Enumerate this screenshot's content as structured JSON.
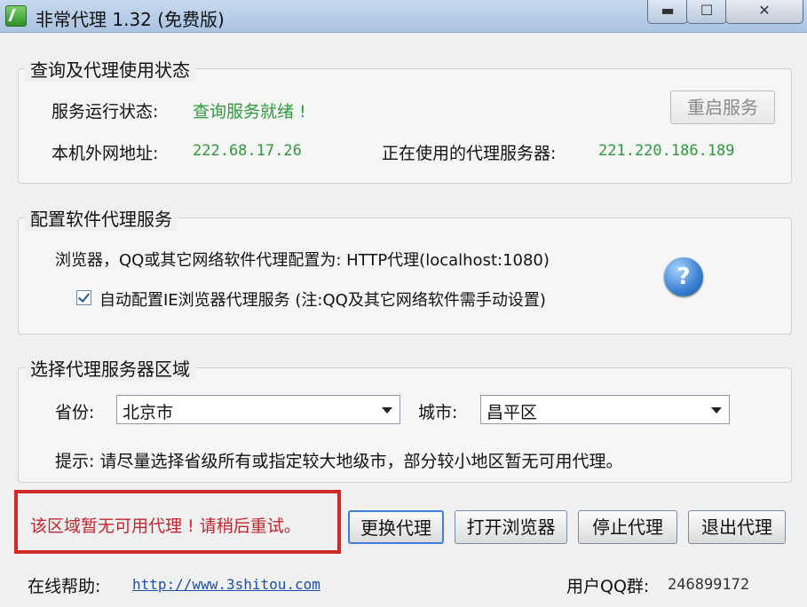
{
  "window": {
    "title": "非常代理 1.32  (免费版)",
    "min_symbol": "▬",
    "max_symbol": "☐",
    "close_symbol": "✕"
  },
  "status_group": {
    "legend": "查询及代理使用状态",
    "service_label": "服务运行状态:",
    "service_value": "查询服务就绪 !",
    "ip_label": "本机外网地址:",
    "ip_value": "222.68.17.26",
    "proxy_label": "正在使用的代理服务器:",
    "proxy_value": "221.220.186.189",
    "restart_button": "重启服务"
  },
  "config_group": {
    "legend": "配置软件代理服务",
    "info": "浏览器，QQ或其它网络软件代理配置为: HTTP代理(localhost:1080)",
    "checkbox_label": "自动配置IE浏览器代理服务 (注:QQ及其它网络软件需手动设置)",
    "checkbox_checked": true,
    "help_symbol": "?"
  },
  "region_group": {
    "legend": "选择代理服务器区域",
    "province_label": "省份:",
    "province_value": "北京市",
    "city_label": "城市:",
    "city_value": "昌平区",
    "hint": "提示: 请尽量选择省级所有或指定较大地级市，部分较小地区暂无可用代理。"
  },
  "warning": "该区域暂无可用代理 ! 请稍后重试。",
  "buttons": {
    "change": "更换代理",
    "open_browser": "打开浏览器",
    "stop": "停止代理",
    "exit": "退出代理"
  },
  "footer": {
    "help_label": "在线帮助:",
    "help_link": "http://www.3shitou.com",
    "qq_group_label": "用户QQ群:",
    "qq_group_value": "246899172"
  }
}
